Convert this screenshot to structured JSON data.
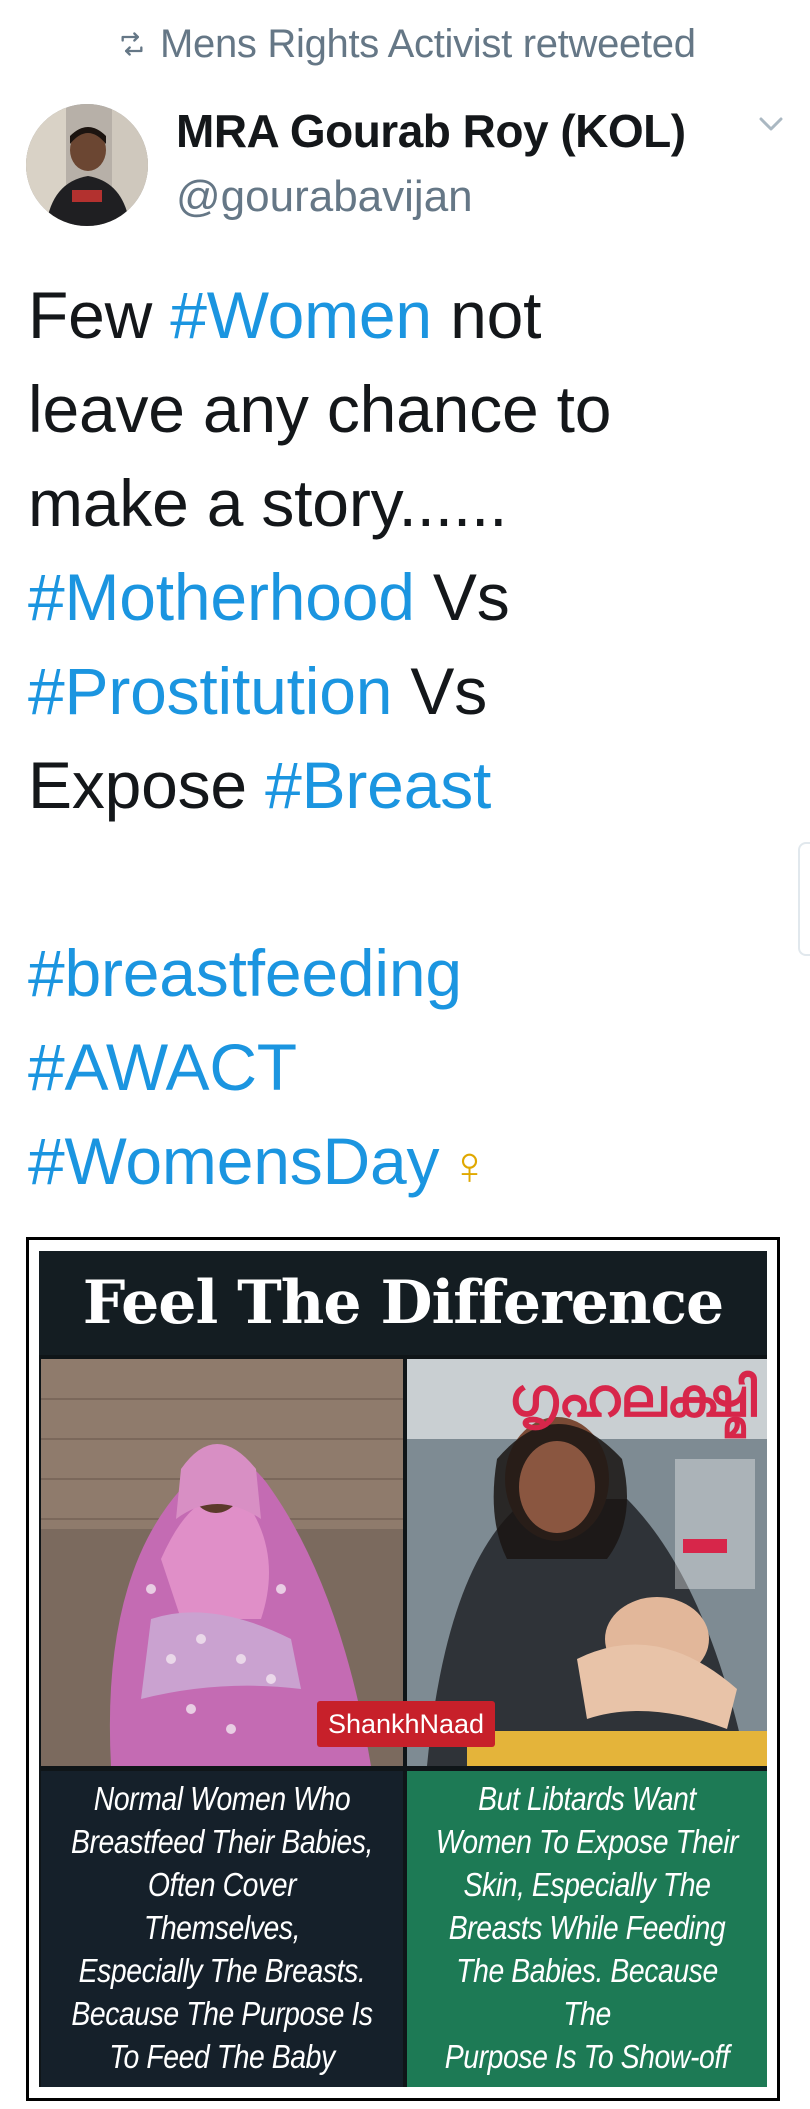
{
  "retweet": {
    "icon": "retweet-icon",
    "text": "Mens Rights Activist retweeted"
  },
  "author": {
    "name": "MRA Gourab Roy (KOL)",
    "handle": "@gourabavijan"
  },
  "tweet": {
    "lines": [
      [
        {
          "t": "Few ",
          "tag": false
        },
        {
          "t": "#Women",
          "tag": true
        },
        {
          "t": " not",
          "tag": false
        }
      ],
      [
        {
          "t": "leave any chance to",
          "tag": false
        }
      ],
      [
        {
          "t": "make a story......",
          "tag": false
        }
      ],
      [
        {
          "t": "#Motherhood",
          "tag": true
        },
        {
          "t": "  Vs",
          "tag": false
        }
      ],
      [
        {
          "t": "#Prostitution",
          "tag": true
        },
        {
          "t": "  Vs",
          "tag": false
        }
      ],
      [
        {
          "t": "Expose ",
          "tag": false
        },
        {
          "t": "#Breast",
          "tag": true
        }
      ],
      [],
      [
        {
          "t": "#breastfeeding",
          "tag": true
        }
      ],
      [
        {
          "t": "#AWACT",
          "tag": true
        }
      ],
      [
        {
          "t": "#WomensDay",
          "tag": true
        },
        {
          "t": "♀",
          "tag": false,
          "emoji": true
        }
      ]
    ]
  },
  "media": {
    "banner": "Feel The Difference",
    "magazine_title": "ഗൃഹലക്ഷ്മി",
    "watermark": "ShankhNaad",
    "left_caption": "Normal Women Who\nBreastfeed Their Babies,\nOften Cover Themselves,\nEspecially The Breasts.\nBecause The Purpose Is\nTo Feed The Baby\n& Nothing Else",
    "right_caption": "But Libtards Want\nWomen To Expose Their\nSkin, Especially The\nBreasts While Feeding\nThe Babies. Because The\nPurpose Is To Show-off\n& Nothing Else"
  },
  "colors": {
    "hashtag": "#1b95e0",
    "text": "#14171a",
    "muted": "#657786",
    "left_panel": "#15202a",
    "right_panel": "#1d7a55",
    "magazine_title": "#d7264a"
  }
}
